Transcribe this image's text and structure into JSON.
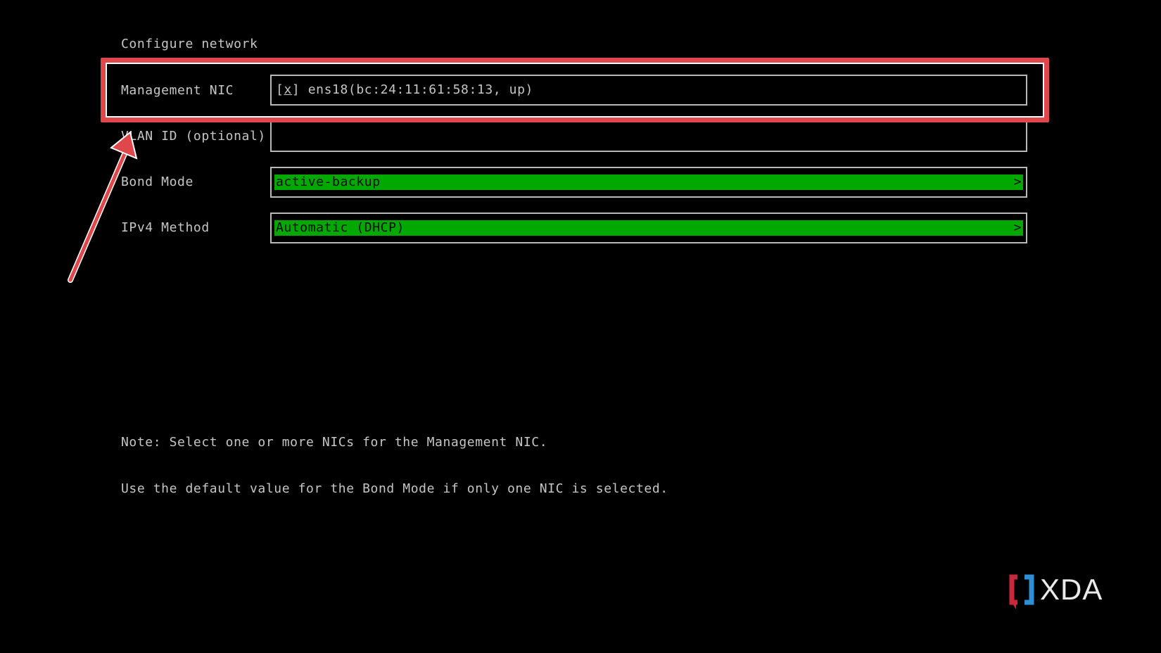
{
  "screen": {
    "title": "Configure network"
  },
  "form": {
    "management_nic": {
      "label": "Management NIC",
      "checkbox_open": "[",
      "checkbox_mark": "x",
      "checkbox_close": "]",
      "value": " ens18(bc:24:11:61:58:13, up)"
    },
    "vlan_id": {
      "label": "VLAN ID (optional)",
      "value": ""
    },
    "bond_mode": {
      "label": "Bond Mode",
      "value": "active-backup",
      "chevron": ">"
    },
    "ipv4_method": {
      "label": "IPv4 Method",
      "value": "Automatic (DHCP)",
      "chevron": ">"
    }
  },
  "note": {
    "line1": "Note: Select one or more NICs for the Management NIC.",
    "line2": "Use the default value for the Bond Mode if only one NIC is selected."
  },
  "watermark": {
    "text": "XDA"
  },
  "colors": {
    "background": "#000000",
    "text": "#c6c6c6",
    "select_bar": "#00a800",
    "annotation": "#e0474a"
  },
  "icons": {
    "annotation_arrow": "arrow-up-right-icon",
    "dropdown_chevron": "chevron-right-icon",
    "brand_logo": "xda-logo-icon"
  }
}
